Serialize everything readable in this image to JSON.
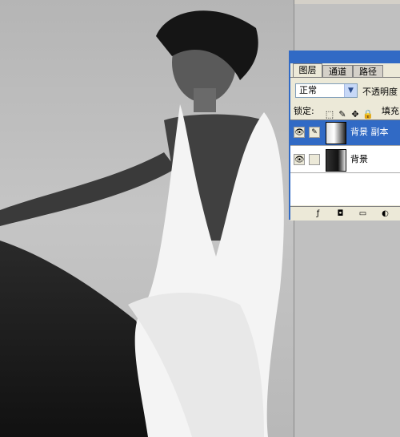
{
  "canvas": {
    "description_icon": "photo-canvas"
  },
  "layers_panel": {
    "tabs": [
      "图层",
      "通道",
      "路径"
    ],
    "blend_mode": "正常",
    "opacity_label": "不透明度",
    "lock_label": "锁定:",
    "fill_label": "填充",
    "layers": [
      {
        "name": "背景 副本",
        "selected": true
      },
      {
        "name": "背景",
        "selected": false
      }
    ],
    "footer_icons": [
      "link-icon",
      "mask-icon",
      "folder-icon",
      "adjustment-icon"
    ]
  },
  "colors": {
    "accent": "#316ac5",
    "panel_bg": "#ece9d8"
  }
}
